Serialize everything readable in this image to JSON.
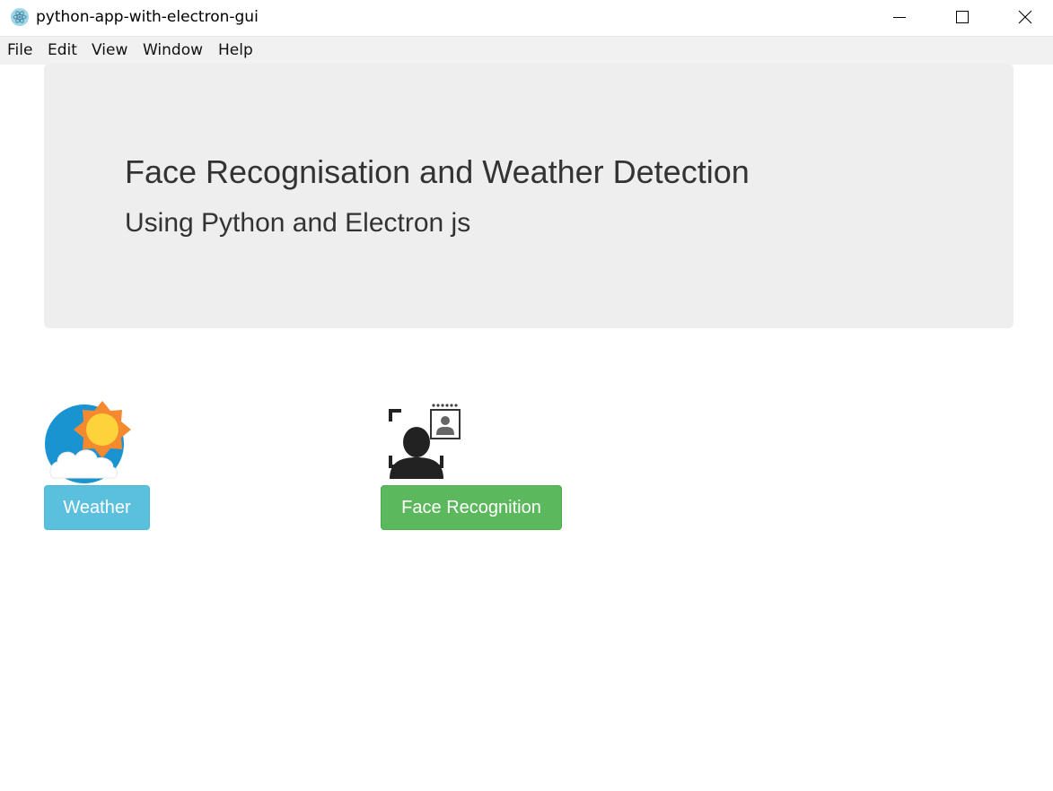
{
  "window": {
    "title": "python-app-with-electron-gui",
    "controls": [
      "minimize-icon",
      "maximize-icon",
      "close-icon"
    ]
  },
  "menu": {
    "items": [
      {
        "label": "File"
      },
      {
        "label": "Edit"
      },
      {
        "label": "View"
      },
      {
        "label": "Window"
      },
      {
        "label": "Help"
      }
    ]
  },
  "jumbotron": {
    "title": "Face Recognisation and Weather Detection",
    "subtitle": "Using Python and Electron js"
  },
  "actions": {
    "weather": {
      "icon": "weather-icon",
      "label": "Weather",
      "color": "#5bc0de"
    },
    "face": {
      "icon": "face-recognition-icon",
      "label": "Face Recognition",
      "color": "#5cb85c"
    }
  }
}
